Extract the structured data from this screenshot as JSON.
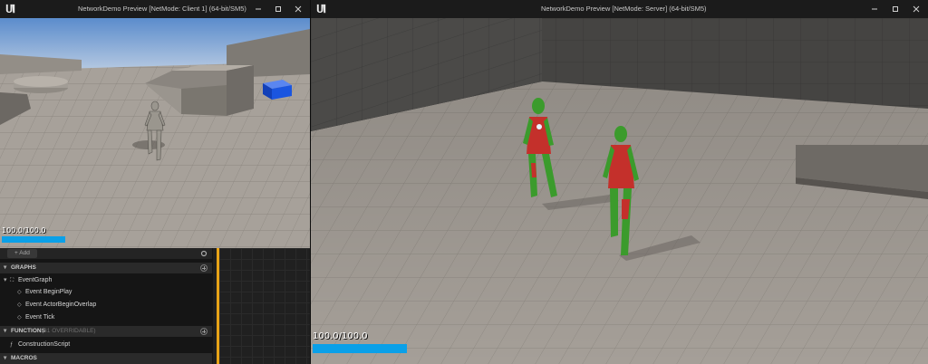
{
  "client_window": {
    "title": "NetworkDemo Preview [NetMode: Client 1]  (64-bit/SM5)",
    "health_text": "100.0/100.0",
    "health_fraction": 1.0
  },
  "server_window": {
    "title": "NetworkDemo Preview [NetMode: Server]  (64-bit/SM5)",
    "health_text": "100.0/100.0",
    "health_fraction": 1.0
  },
  "window_controls": [
    "minimize-icon",
    "maximize-icon",
    "close-icon"
  ],
  "my_blueprint": {
    "add_label": "+ Add",
    "graphs_header": "GRAPHS",
    "event_graph": "EventGraph",
    "events": [
      "Event BeginPlay",
      "Event ActorBeginOverlap",
      "Event Tick"
    ],
    "functions_header": "FUNCTIONS",
    "functions_overridable": "(31 OVERRIDABLE)",
    "construction_script": "ConstructionScript",
    "macros_header": "MACROS"
  },
  "colors": {
    "health_bar": "#0aa0e8",
    "graph_border": "#e8a317",
    "character_client": "#9a968e",
    "character_server_green": "#3b9b2c",
    "character_server_red": "#c4302b",
    "cube": "#1a55e0"
  }
}
